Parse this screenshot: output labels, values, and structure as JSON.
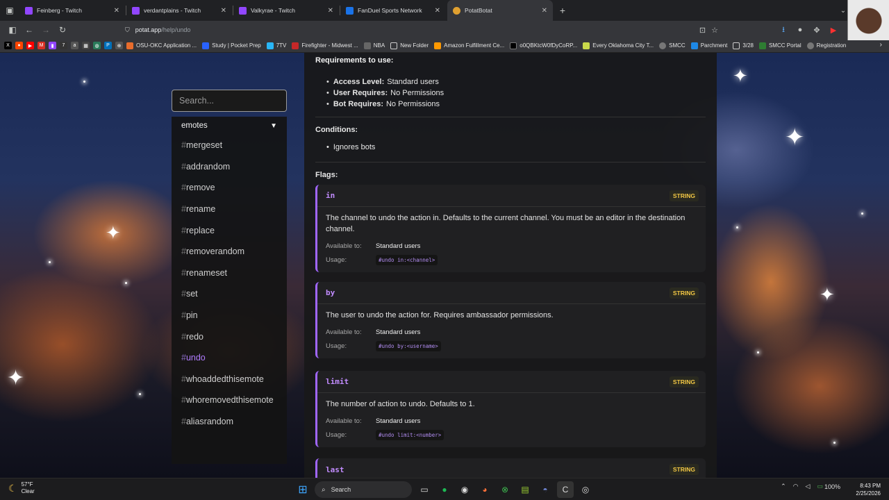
{
  "browser": {
    "tabs": [
      {
        "title": "Feinberg - Twitch",
        "color": "#9146ff"
      },
      {
        "title": "verdantplains - Twitch",
        "color": "#9146ff"
      },
      {
        "title": "Valkyrae - Twitch",
        "color": "#9146ff"
      },
      {
        "title": "FanDuel Sports Network",
        "color": "#1a73e8"
      },
      {
        "title": "PotatBotat",
        "color": "#e0a030",
        "active": true
      }
    ],
    "url_host": "potat.app",
    "url_path": "/help/undo",
    "bookmarks": [
      "OSU-OKC Application ...",
      "Study | Pocket Prep",
      "7TV",
      "Firefighter - Midwest ...",
      "NBA",
      "New Folder",
      "Amazon Fulfillment Ce...",
      "o0QBKtcW0fDyCoRP...",
      "Every Oklahoma City T...",
      "SMCC",
      "Parchment",
      "3/28",
      "SMCC Portal",
      "Registration"
    ]
  },
  "sidebar": {
    "search_placeholder": "Search...",
    "category": "emotes",
    "items": [
      {
        "name": "mergeset"
      },
      {
        "name": "addrandom"
      },
      {
        "name": "remove"
      },
      {
        "name": "rename"
      },
      {
        "name": "replace"
      },
      {
        "name": "removerandom"
      },
      {
        "name": "renameset"
      },
      {
        "name": "set"
      },
      {
        "name": "pin"
      },
      {
        "name": "redo"
      },
      {
        "name": "undo",
        "active": true
      },
      {
        "name": "whoaddedthisemote"
      },
      {
        "name": "whoremovedthisemote"
      },
      {
        "name": "aliasrandom"
      }
    ]
  },
  "main": {
    "requirements_title": "Requirements to use:",
    "requirements": [
      {
        "label": "Access Level:",
        "value": "Standard users"
      },
      {
        "label": "User Requires:",
        "value": "No Permissions"
      },
      {
        "label": "Bot Requires:",
        "value": "No Permissions"
      }
    ],
    "conditions_title": "Conditions:",
    "conditions": [
      "Ignores bots"
    ],
    "flags_title": "Flags:",
    "available_label": "Available to:",
    "usage_label": "Usage:",
    "flags": [
      {
        "name": "in",
        "type": "STRING",
        "description": "The channel to undo the action in. Defaults to the current channel. You must be an editor in the destination channel.",
        "available": "Standard users",
        "usage": "#undo in:<channel>"
      },
      {
        "name": "by",
        "type": "STRING",
        "description": "The user to undo the action for. Requires ambassador permissions.",
        "available": "Standard users",
        "usage": "#undo by:<username>"
      },
      {
        "name": "limit",
        "type": "STRING",
        "description": "The number of action to undo. Defaults to 1.",
        "available": "Standard users",
        "usage": "#undo limit:<number>"
      },
      {
        "name": "last",
        "type": "STRING"
      }
    ]
  },
  "taskbar": {
    "weather_temp": "57°F",
    "weather_desc": "Clear",
    "search_label": "Search",
    "battery": "100%",
    "time": "8:43 PM",
    "date": "2/25/2026"
  }
}
